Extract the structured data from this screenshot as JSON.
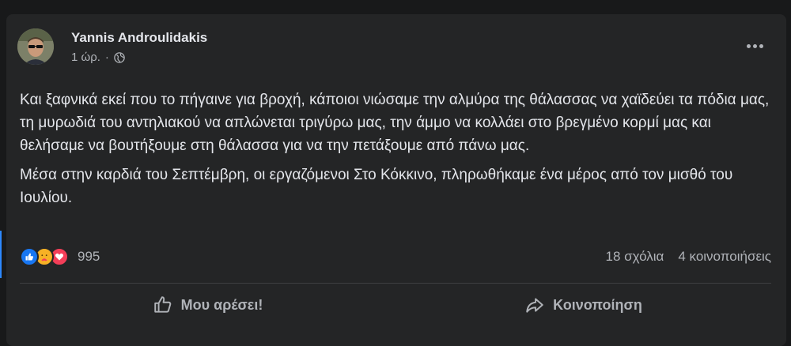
{
  "post": {
    "author": "Yannis Androulidakis",
    "time": "1 ώρ.",
    "separator": "·",
    "privacy_icon": "globe-icon",
    "paragraphs": [
      "Και ξαφνικά εκεί που το πήγαινε για βροχή, κάποιοι νιώσαμε την αλμύρα της θάλασσας να χαϊδεύει τα πόδια μας, τη μυρωδιά του αντηλιακού να απλώνεται τριγύρω μας, την άμμο να κολλάει στο βρεγμένο κορμί μας και θελήσαμε να βουτήξουμε στη θάλασσα για να την πετάξουμε από πάνω μας.",
      "Μέσα στην καρδιά του Σεπτέμβρη, οι εργαζόμενοι Στο Κόκκινο, πληρωθήκαμε ένα μέρος από τον μισθό του Ιουλίου."
    ]
  },
  "engagement": {
    "reaction_icons": [
      "like-icon",
      "care-icon",
      "love-icon"
    ],
    "reactions_count": "995",
    "comments": "18 σχόλια",
    "shares": "4 κοινοποιήσεις"
  },
  "actions": {
    "like_label": "Μου αρέσει!",
    "share_label": "Κοινοποίηση"
  },
  "colors": {
    "background": "#18191a",
    "card": "#242526",
    "text": "#e4e6eb",
    "secondary_text": "#b0b3b8",
    "like_blue": "#1877f2",
    "care_yellow": "#f7b125",
    "love_red": "#f33e58"
  }
}
